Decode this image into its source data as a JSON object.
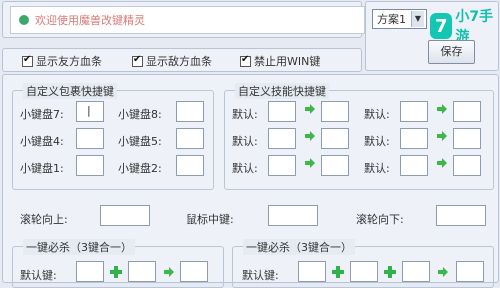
{
  "header": {
    "welcome_text": "欢迎使用魔兽改键精灵",
    "scheme_select": "方案1",
    "save_label": "保存",
    "logo_mark": "7",
    "logo_text": "小7手游"
  },
  "options": [
    {
      "label": "显示友方血条",
      "checked": true
    },
    {
      "label": "显示敌方血条",
      "checked": true
    },
    {
      "label": "禁止用WIN键",
      "checked": true
    }
  ],
  "inventory_group": {
    "title": "自定义包裹快捷键",
    "slots": [
      {
        "label": "小键盘7:",
        "value": "|"
      },
      {
        "label": "小键盘8:",
        "value": ""
      },
      {
        "label": "小键盘4:",
        "value": ""
      },
      {
        "label": "小键盘5:",
        "value": ""
      },
      {
        "label": "小键盘1:",
        "value": ""
      },
      {
        "label": "小键盘2:",
        "value": ""
      }
    ]
  },
  "skill_group": {
    "title": "自定义技能快捷键",
    "row_label": "默认:"
  },
  "wheel": {
    "up_label": "滚轮向上:",
    "middle_label": "鼠标中键:",
    "down_label": "滚轮向下:"
  },
  "combo_left": {
    "title": "一键必杀（3键合一）",
    "label": "默认键:"
  },
  "combo_right": {
    "title": "一键必杀（3键合一）",
    "label": "默认键:"
  },
  "colors": {
    "arrow": "#3cb84a",
    "plus": "#2fb24a",
    "accent": "#13c7b4"
  }
}
